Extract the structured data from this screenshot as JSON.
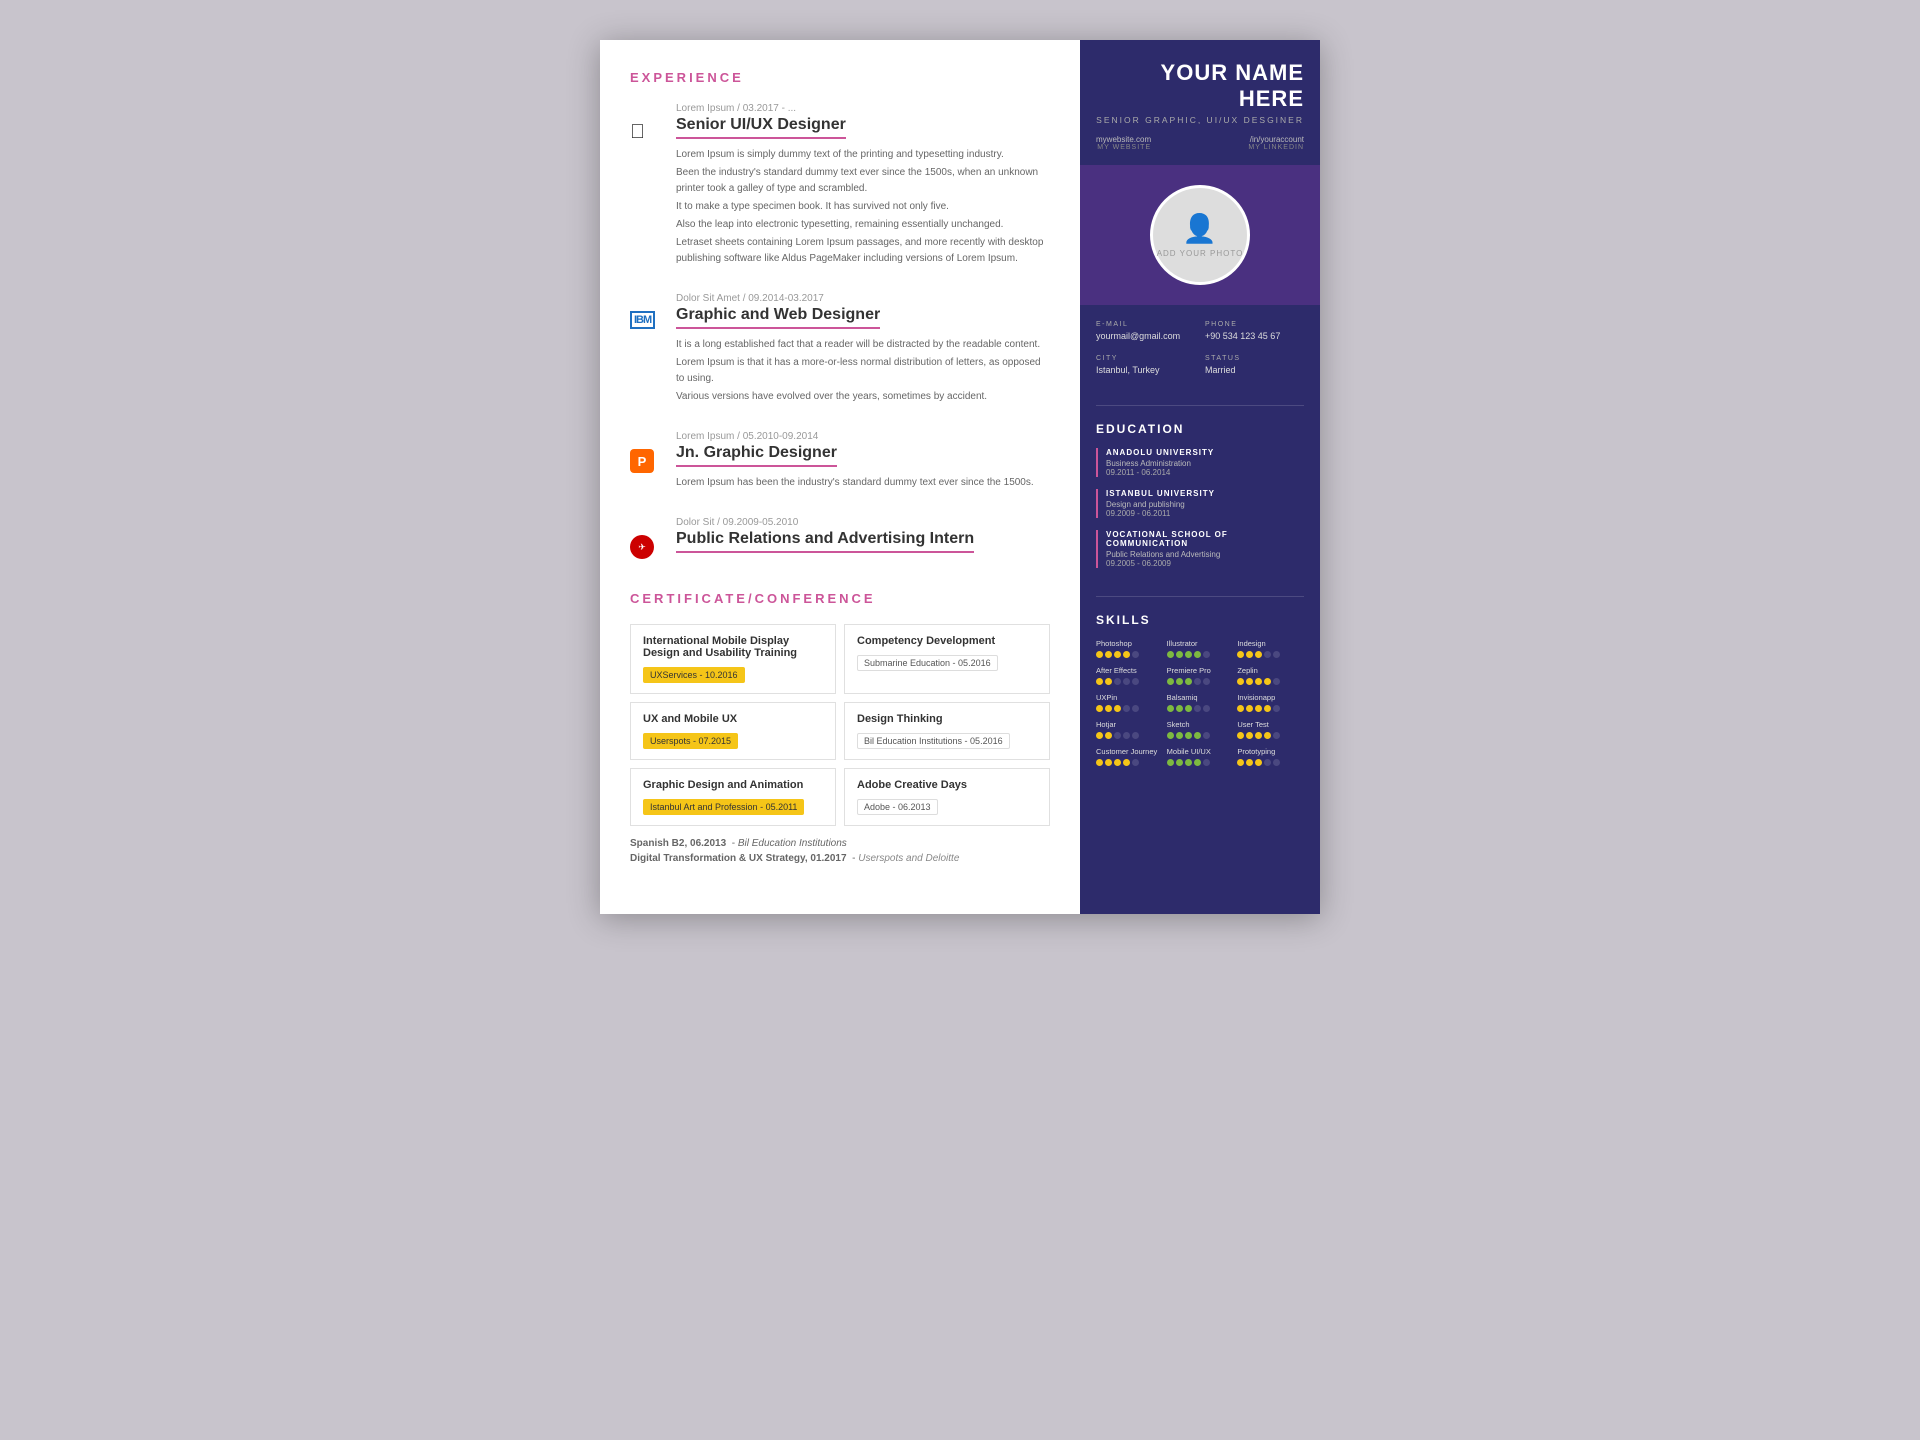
{
  "header": {
    "name": "YOUR NAME HERE",
    "title": "SENIOR GRAPHIC, UI/UX DESGINER",
    "website": "mywebsite.com",
    "website_label": "MY WEBSITE",
    "linkedin": "/in/youraccount",
    "linkedin_label": "MY LINKEDIN",
    "photo_text": "ADD YOUR PHOTO"
  },
  "contact": {
    "email_label": "E-MAIL",
    "email": "yourmail@gmail.com",
    "phone_label": "PHONE",
    "phone": "+90 534 123 45 67",
    "city_label": "CITY",
    "city": "Istanbul, Turkey",
    "status_label": "STATUS",
    "status": "Married"
  },
  "education": {
    "section_title": "EDUCATION",
    "items": [
      {
        "school": "ANADOLU UNIVERSITY",
        "field": "Business Administration",
        "dates": "09.2011 - 06.2014"
      },
      {
        "school": "ISTANBUL UNIVERSITY",
        "field": "Design and publishing",
        "dates": "09.2009 - 06.2011"
      },
      {
        "school": "VOCATIONAL SCHOOL OF COMMUNICATION",
        "field": "Public Relations and Advertising",
        "dates": "09.2005 - 06.2009"
      }
    ]
  },
  "skills": {
    "section_title": "SKILLS",
    "items": [
      {
        "name": "Photoshop",
        "filled": 4,
        "total": 5
      },
      {
        "name": "Illustrator",
        "filled": 4,
        "total": 5
      },
      {
        "name": "Indesign",
        "filled": 3,
        "total": 5
      },
      {
        "name": "After Effects",
        "filled": 2,
        "total": 5
      },
      {
        "name": "Premiere Pro",
        "filled": 3,
        "total": 5
      },
      {
        "name": "Zeplin",
        "filled": 4,
        "total": 5
      },
      {
        "name": "UXPin",
        "filled": 3,
        "total": 5
      },
      {
        "name": "Balsamiq",
        "filled": 3,
        "total": 5
      },
      {
        "name": "Invisionapp",
        "filled": 4,
        "total": 5
      },
      {
        "name": "Hotjar",
        "filled": 2,
        "total": 5
      },
      {
        "name": "Sketch",
        "filled": 4,
        "total": 5
      },
      {
        "name": "User Test",
        "filled": 4,
        "total": 5
      },
      {
        "name": "Customer Journey",
        "filled": 4,
        "total": 5
      },
      {
        "name": "Mobile UI/UX",
        "filled": 4,
        "total": 5
      },
      {
        "name": "Prototyping",
        "filled": 3,
        "total": 5
      }
    ]
  },
  "experience": {
    "section_title": "EXPERIENCE",
    "items": [
      {
        "company": "Lorem Ipsum",
        "date": "Lorem Ipsum / 03.2017 - ...",
        "title": "Senior UI/UX Designer",
        "logo_type": "apple",
        "descriptions": [
          "Lorem Ipsum is simply dummy text of the printing and typesetting industry.",
          "Been the industry's standard dummy text ever since the 1500s, when an unknown printer took a galley of type and scrambled.",
          "It to make a type specimen book. It has survived not only five.",
          "Also the leap into electronic typesetting, remaining essentially unchanged.",
          "Letraset sheets containing Lorem Ipsum passages, and more recently with desktop publishing software like Aldus PageMaker including versions of Lorem Ipsum."
        ]
      },
      {
        "company": "IBM",
        "date": "Dolor Sit Amet / 09.2014-03.2017",
        "title": "Graphic and Web Designer",
        "logo_type": "ibm",
        "descriptions": [
          "It is a long established fact that a reader will be distracted by the readable content.",
          "Lorem Ipsum is that it has a more-or-less normal distribution of letters, as opposed to using.",
          "Various versions have evolved over the years, sometimes by accident."
        ]
      },
      {
        "company": "P",
        "date": "Lorem Ipsum / 05.2010-09.2014",
        "title": "Jn. Graphic Designer",
        "logo_type": "p",
        "descriptions": [
          "Lorem Ipsum has been the industry's standard dummy text ever since the 1500s."
        ]
      },
      {
        "company": "Turkish Airlines",
        "date": "Dolor Sit / 09.2009-05.2010",
        "title": "Public Relations and Advertising Intern",
        "logo_type": "turkish",
        "descriptions": []
      }
    ]
  },
  "certificates": {
    "section_title": "CERTIFICATE/CONFERENCE",
    "items": [
      {
        "name": "International Mobile Display Design and Usability Training",
        "provider": "UXServices - 10.2016"
      },
      {
        "name": "Competency Development",
        "provider": "Submarine Education - 05.2016"
      },
      {
        "name": "UX and Mobile UX",
        "provider": "Userspots - 07.2015"
      },
      {
        "name": "Design Thinking",
        "provider": "Bil Education Institutions - 05.2016"
      },
      {
        "name": "Graphic Design and Animation",
        "provider": "Istanbul Art and Profession - 05.2011"
      },
      {
        "name": "Adobe Creative Days",
        "provider": "Adobe - 06.2013"
      }
    ],
    "lang": "Spanish B2, 06.2013",
    "lang_provider": "Bil Education Institutions",
    "digital": "Digital Transformation & UX Strategy, 01.2017",
    "digital_provider": "Userspots and Deloitte"
  }
}
